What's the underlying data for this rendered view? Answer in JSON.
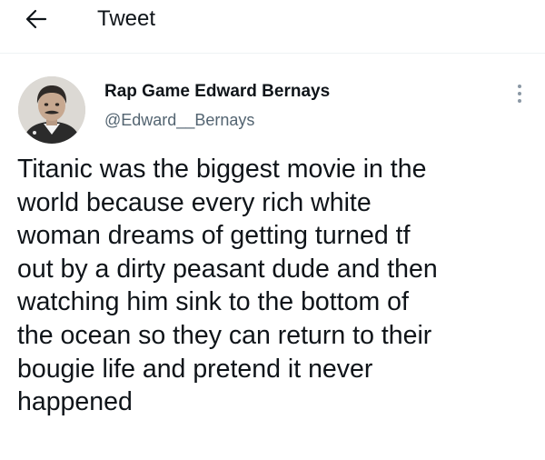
{
  "header": {
    "back_icon": "arrow-left-icon",
    "title": "Tweet"
  },
  "author": {
    "display_name": "Rap Game Edward Bernays",
    "handle": "@Edward__Bernays",
    "avatar_icon": "profile-photo"
  },
  "tweet": {
    "lines": [
      "Titanic was the biggest movie in the",
      "world because every rich white",
      "woman dreams of getting turned tf",
      "out by a dirty peasant dude and then",
      "watching him sink to the bottom of",
      "the ocean so they can return to their",
      "bougie life and pretend it never",
      "happened"
    ],
    "more_icon": "more-vertical-icon"
  },
  "colors": {
    "text_primary": "#0f1419",
    "text_secondary": "#536471",
    "divider": "#eff3f4"
  }
}
